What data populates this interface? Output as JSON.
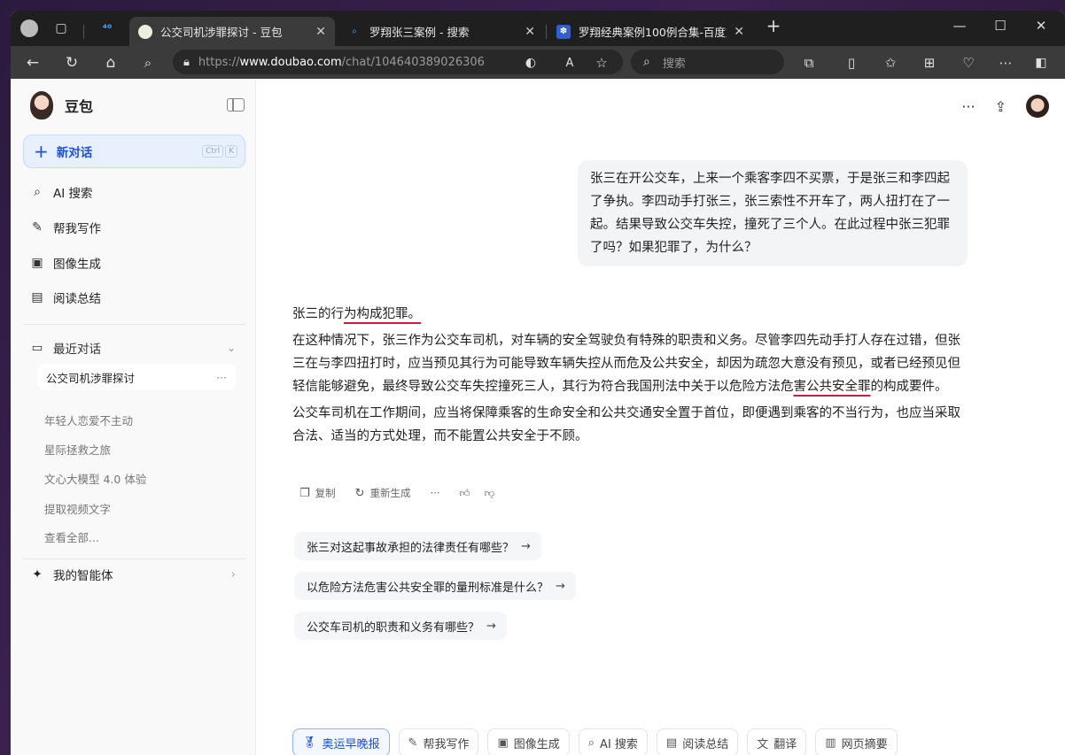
{
  "browser": {
    "tabs": [
      {
        "title": "公交司机涉罪探讨 - 豆包",
        "active": true
      },
      {
        "title": "罗翔张三案例 - 搜索",
        "active": false
      },
      {
        "title": "罗翔经典案例100例合集-百度文库",
        "active": false
      }
    ],
    "new_tab": "+",
    "url_prefix": "https://",
    "url_host": "www.doubao.com",
    "url_path": "/chat/104640389026306",
    "search_placeholder": "搜索",
    "window_controls": {
      "minimize": "—",
      "maximize": "☐",
      "close": "✕"
    }
  },
  "sidebar": {
    "brand": "豆包",
    "new_chat": {
      "label": "新对话",
      "kbd": [
        "Ctrl",
        "K"
      ]
    },
    "menu": [
      {
        "label": "AI 搜索",
        "icon": "ai-search-icon"
      },
      {
        "label": "帮我写作",
        "icon": "pen-icon"
      },
      {
        "label": "图像生成",
        "icon": "image-icon"
      },
      {
        "label": "阅读总结",
        "icon": "reader-icon"
      }
    ],
    "recent_title": "最近对话",
    "recent": [
      "公交司机涉罪探讨",
      "年轻人恋爱不主动",
      "星际拯救之旅",
      "文心大模型 4.0 体验",
      "提取视频文字",
      "查看全部..."
    ],
    "agents": "我的智能体"
  },
  "chat": {
    "user_message": "张三在开公交车，上来一个乘客李四不买票，于是张三和李四起了争执。李四动手打张三，张三索性不开车了，两人扭打在了一起。结果导致公交车失控，撞死了三个人。在此过程中张三犯罪了吗？如果犯罪了，为什么？",
    "answer_lead_a": "张三的行",
    "answer_lead_b": "为构成犯罪。",
    "answer_p1_a": "在这种情况下，张三作为公交车司机，对车辆的安全驾驶负有特殊的职责和义务。尽管李四先动手打人存在过错，但张三在与李四扭打时，应当预见其行为可能导致车辆失控从而危及公共安全，却因为疏忽大意没有预见，或者已经预见但轻信能够避免，最终导致公交车失控撞死三人，其行为符合我国刑法中关于以危险方法危",
    "answer_p1_b": "害公共安全罪",
    "answer_p1_c": "的构成要件。",
    "answer_p2": "公交车司机在工作期间，应当将保障乘客的生命安全和公共交通安全置于首位，即便遇到乘客的不当行为，也应当采取合法、适当的方式处理，而不能置公共安全于不顾。",
    "actions": {
      "copy": "复制",
      "regenerate": "重新生成"
    },
    "suggestions": [
      "张三对这起事故承担的法律责任有哪些？",
      "以危险方法危害公共安全罪的量刑标准是什么？",
      "公交车司机的职责和义务有哪些？"
    ],
    "tools": [
      {
        "label": "奥运早晚报",
        "icon": "medal-icon"
      },
      {
        "label": "帮我写作",
        "icon": "pen-icon"
      },
      {
        "label": "图像生成",
        "icon": "image-icon"
      },
      {
        "label": "AI 搜索",
        "icon": "ai-search-icon"
      },
      {
        "label": "阅读总结",
        "icon": "reader-icon"
      },
      {
        "label": "翻译",
        "icon": "translate-icon"
      },
      {
        "label": "网页摘要",
        "icon": "page-summary-icon"
      }
    ]
  }
}
